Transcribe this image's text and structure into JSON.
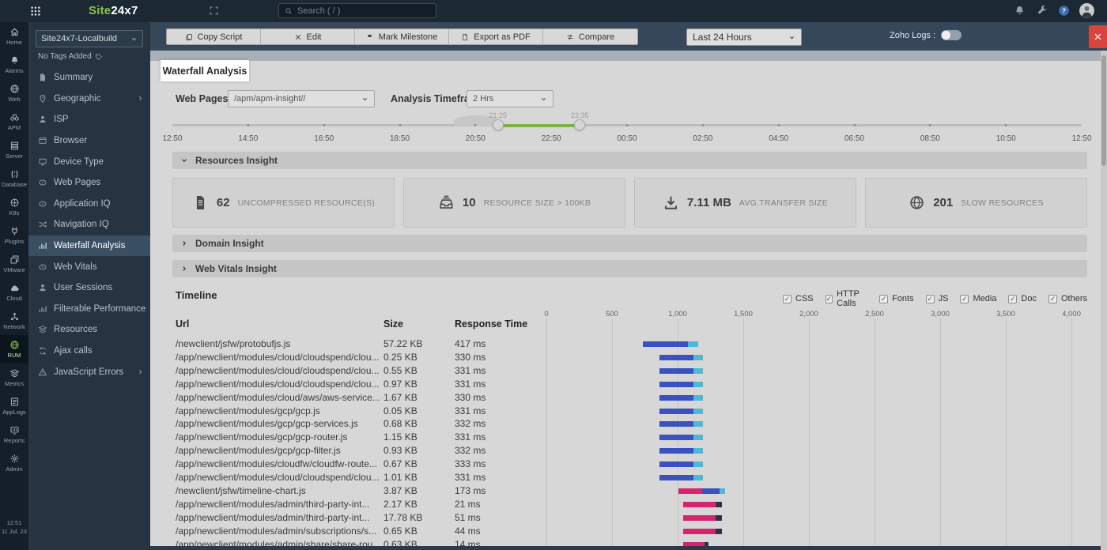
{
  "topbar": {
    "logo_prefix": "Site",
    "logo_suffix": "24x7",
    "search_placeholder": "Search ( / )"
  },
  "theme": {
    "accent_green": "#7cb342",
    "close_red": "#d9453c",
    "topbar_bg": "#1c2934",
    "sidebar_bg": "#263441",
    "toolbar_bg": "#36475a"
  },
  "rail": {
    "items": [
      {
        "label": "Home",
        "icon": "home",
        "active": false
      },
      {
        "label": "Alarms",
        "icon": "bell",
        "active": false
      },
      {
        "label": "Web",
        "icon": "globe",
        "active": false
      },
      {
        "label": "APM",
        "icon": "binoculars",
        "active": false
      },
      {
        "label": "Server",
        "icon": "server",
        "active": false
      },
      {
        "label": "Database",
        "icon": "database",
        "active": false
      },
      {
        "label": "K8s",
        "icon": "k8s",
        "active": false
      },
      {
        "label": "Plugins",
        "icon": "plug",
        "active": false
      },
      {
        "label": "VMware",
        "icon": "vmware",
        "active": false
      },
      {
        "label": "Cloud",
        "icon": "cloud",
        "active": false
      },
      {
        "label": "Network",
        "icon": "network",
        "active": false
      },
      {
        "label": "RUM",
        "icon": "globe",
        "active": true
      },
      {
        "label": "Metrics",
        "icon": "layers",
        "active": false
      },
      {
        "label": "AppLogs",
        "icon": "applogs",
        "active": false
      },
      {
        "label": "Reports",
        "icon": "reports",
        "active": false
      },
      {
        "label": "Admin",
        "icon": "gear",
        "active": false
      }
    ],
    "time": "12:51",
    "date": "11 Jul, 23"
  },
  "sidebar": {
    "monitor_name": "Site24x7-Localbuild",
    "tags_label": "No Tags Added",
    "items": [
      {
        "label": "Summary",
        "icon": "doc",
        "active": false,
        "has_children": false
      },
      {
        "label": "Geographic",
        "icon": "pin",
        "active": false,
        "has_children": true
      },
      {
        "label": "ISP",
        "icon": "person",
        "active": false,
        "has_children": false
      },
      {
        "label": "Browser",
        "icon": "browser",
        "active": false,
        "has_children": false
      },
      {
        "label": "Device Type",
        "icon": "monitor",
        "active": false,
        "has_children": false
      },
      {
        "label": "Web Pages",
        "icon": "page",
        "active": false,
        "has_children": false
      },
      {
        "label": "Application IQ",
        "icon": "page",
        "active": false,
        "has_children": false
      },
      {
        "label": "Navigation IQ",
        "icon": "shuffle",
        "active": false,
        "has_children": false
      },
      {
        "label": "Waterfall Analysis",
        "icon": "chart",
        "active": true,
        "has_children": false
      },
      {
        "label": "Web Vitals",
        "icon": "page",
        "active": false,
        "has_children": false
      },
      {
        "label": "User Sessions",
        "icon": "person",
        "active": false,
        "has_children": false
      },
      {
        "label": "Filterable Performance",
        "icon": "chart",
        "active": false,
        "has_children": false
      },
      {
        "label": "Resources",
        "icon": "layers",
        "active": false,
        "has_children": false
      },
      {
        "label": "Ajax calls",
        "icon": "refresh",
        "active": false,
        "has_children": false
      },
      {
        "label": "JavaScript Errors",
        "icon": "warning",
        "active": false,
        "has_children": true
      }
    ]
  },
  "toolbar": {
    "buttons": [
      {
        "label": "Copy Script",
        "icon": "copy"
      },
      {
        "label": "Edit",
        "icon": "pencilx"
      },
      {
        "label": "Mark Milestone",
        "icon": "flag"
      },
      {
        "label": "Export as PDF",
        "icon": "filepdf"
      },
      {
        "label": "Compare",
        "icon": "compare"
      }
    ],
    "time_range": "Last 24 Hours",
    "zoho_logs_label": "Zoho Logs :"
  },
  "page": {
    "tab_title": "Waterfall Analysis",
    "filters": {
      "web_pages_label": "Web Pages",
      "web_pages_value": "/apm/apm-insight//",
      "timeframe_label": "Analysis Timeframe",
      "timeframe_value": "2 Hrs"
    },
    "slider": {
      "tick_labels": [
        "12:50",
        "14:50",
        "16:50",
        "18:50",
        "20:50",
        "22:50",
        "00:50",
        "02:50",
        "04:50",
        "06:50",
        "08:50",
        "10:50",
        "12:50"
      ],
      "selection": {
        "start_label": "21:25",
        "end_label": "23:35",
        "start_pct": 35.8,
        "end_pct": 44.8
      }
    },
    "insight_sections": [
      {
        "label": "Resources Insight",
        "expanded": true
      },
      {
        "label": "Domain Insight",
        "expanded": false
      },
      {
        "label": "Web Vitals Insight",
        "expanded": false
      }
    ],
    "stat_cards": [
      {
        "icon": "filetext",
        "value": "62",
        "label": "UNCOMPRESSED RESOURCE(S)"
      },
      {
        "icon": "tray",
        "value": "10",
        "label": "RESOURCE SIZE > 100KB"
      },
      {
        "icon": "download",
        "value": "7.11 MB",
        "label": "AVG.TRANSFER SIZE"
      },
      {
        "icon": "globe",
        "value": "201",
        "label": "SLOW RESOURCES"
      }
    ],
    "timeline": {
      "heading": "Timeline",
      "type_filters": [
        {
          "label": "CSS",
          "checked": true
        },
        {
          "label": "HTTP Calls",
          "checked": true
        },
        {
          "label": "Fonts",
          "checked": true
        },
        {
          "label": "JS",
          "checked": true
        },
        {
          "label": "Media",
          "checked": true
        },
        {
          "label": "Doc",
          "checked": true
        },
        {
          "label": "Others",
          "checked": true
        }
      ]
    }
  },
  "chart_data": {
    "type": "waterfall",
    "title": "Timeline",
    "columns": [
      "Url",
      "Size",
      "Response Time"
    ],
    "x_axis": {
      "unit": "ms",
      "min": 0,
      "max": 4000,
      "ticks": [
        "0",
        "500",
        "1,000",
        "1,500",
        "2,000",
        "2,500",
        "3,000",
        "3,500",
        "4,000"
      ]
    },
    "colors": {
      "blue": "#3a52c0",
      "cyan": "#4cb9d8",
      "pink": "#d6256e",
      "navy": "#2b3347"
    },
    "rows": [
      {
        "url": "/newclient/jsfw/protobufjs.js",
        "size": "57.22 KB",
        "response_time": "417 ms",
        "bar": {
          "start": 735,
          "segments": [
            [
              "blue",
              345
            ],
            [
              "cyan",
              75
            ]
          ]
        }
      },
      {
        "url": "/app/newclient/modules/cloud/cloudspend/clou...",
        "size": "0.25 KB",
        "response_time": "330 ms",
        "bar": {
          "start": 862,
          "segments": [
            [
              "blue",
              260
            ],
            [
              "cyan",
              72
            ]
          ]
        }
      },
      {
        "url": "/app/newclient/modules/cloud/cloudspend/clou...",
        "size": "0.55 KB",
        "response_time": "331 ms",
        "bar": {
          "start": 862,
          "segments": [
            [
              "blue",
              260
            ],
            [
              "cyan",
              72
            ]
          ]
        }
      },
      {
        "url": "/app/newclient/modules/cloud/cloudspend/clou...",
        "size": "0.97 KB",
        "response_time": "331 ms",
        "bar": {
          "start": 862,
          "segments": [
            [
              "blue",
              260
            ],
            [
              "cyan",
              72
            ]
          ]
        }
      },
      {
        "url": "/app/newclient/modules/cloud/aws/aws-service...",
        "size": "1.67 KB",
        "response_time": "330 ms",
        "bar": {
          "start": 862,
          "segments": [
            [
              "blue",
              260
            ],
            [
              "cyan",
              72
            ]
          ]
        }
      },
      {
        "url": "/app/newclient/modules/gcp/gcp.js",
        "size": "0.05 KB",
        "response_time": "331 ms",
        "bar": {
          "start": 862,
          "segments": [
            [
              "blue",
              260
            ],
            [
              "cyan",
              72
            ]
          ]
        }
      },
      {
        "url": "/app/newclient/modules/gcp/gcp-services.js",
        "size": "0.68 KB",
        "response_time": "332 ms",
        "bar": {
          "start": 862,
          "segments": [
            [
              "blue",
              260
            ],
            [
              "cyan",
              72
            ]
          ]
        }
      },
      {
        "url": "/app/newclient/modules/gcp/gcp-router.js",
        "size": "1.15 KB",
        "response_time": "331 ms",
        "bar": {
          "start": 862,
          "segments": [
            [
              "blue",
              260
            ],
            [
              "cyan",
              72
            ]
          ]
        }
      },
      {
        "url": "/app/newclient/modules/gcp/gcp-filter.js",
        "size": "0.93 KB",
        "response_time": "332 ms",
        "bar": {
          "start": 862,
          "segments": [
            [
              "blue",
              260
            ],
            [
              "cyan",
              72
            ]
          ]
        }
      },
      {
        "url": "/app/newclient/modules/cloudfw/cloudfw-route...",
        "size": "0.67 KB",
        "response_time": "333 ms",
        "bar": {
          "start": 862,
          "segments": [
            [
              "blue",
              260
            ],
            [
              "cyan",
              72
            ]
          ]
        }
      },
      {
        "url": "/app/newclient/modules/cloud/cloudspend/clou...",
        "size": "1.01 KB",
        "response_time": "331 ms",
        "bar": {
          "start": 862,
          "segments": [
            [
              "blue",
              260
            ],
            [
              "cyan",
              72
            ]
          ]
        }
      },
      {
        "url": "/newclient/jsfw/timeline-chart.js",
        "size": "3.87 KB",
        "response_time": "173 ms",
        "bar": {
          "start": 1005,
          "segments": [
            [
              "pink",
              180
            ],
            [
              "blue",
              135
            ],
            [
              "cyan",
              42
            ]
          ]
        }
      },
      {
        "url": "/app/newclient/modules/admin/third-party-int...",
        "size": "2.17 KB",
        "response_time": "21 ms",
        "bar": {
          "start": 1043,
          "segments": [
            [
              "pink",
              247
            ],
            [
              "navy",
              48
            ]
          ]
        }
      },
      {
        "url": "/app/newclient/modules/admin/third-party-int...",
        "size": "17.78 KB",
        "response_time": "51 ms",
        "bar": {
          "start": 1043,
          "segments": [
            [
              "pink",
              247
            ],
            [
              "navy",
              48
            ]
          ]
        }
      },
      {
        "url": "/app/newclient/modules/admin/subscriptions/s...",
        "size": "0.65 KB",
        "response_time": "44 ms",
        "bar": {
          "start": 1043,
          "segments": [
            [
              "pink",
              247
            ],
            [
              "navy",
              48
            ]
          ]
        }
      },
      {
        "url": "/app/newclient/modules/admin/share/share-rou...",
        "size": "0.63 KB",
        "response_time": "14 ms",
        "bar": {
          "start": 1043,
          "segments": [
            [
              "pink",
              163
            ],
            [
              "navy",
              28
            ]
          ]
        }
      }
    ]
  }
}
